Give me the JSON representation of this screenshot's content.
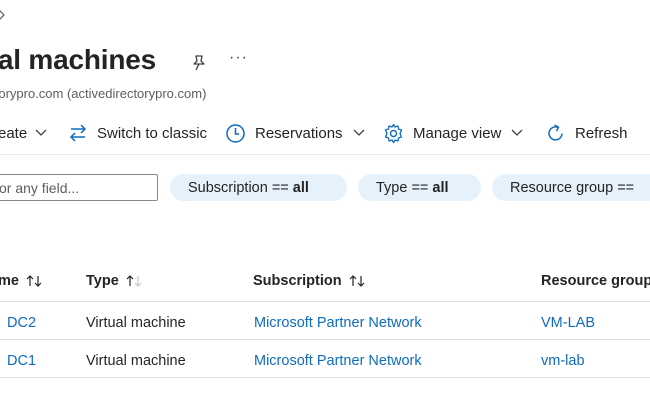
{
  "header": {
    "title": "ual machines",
    "subtitle": "ectorypro.com (activedirectorypro.com)",
    "more_label": "···"
  },
  "toolbar": {
    "create_label": "eate",
    "switch_label": "Switch to classic",
    "reservations_label": "Reservations",
    "manage_view_label": "Manage view",
    "refresh_label": "Refresh"
  },
  "filters": {
    "search_placeholder": "or any field...",
    "pills": [
      {
        "key": "Subscription ==",
        "value": "all"
      },
      {
        "key": "Type ==",
        "value": "all"
      },
      {
        "key": "Resource group ==",
        "value": ""
      }
    ]
  },
  "table": {
    "headers": [
      "me",
      "Type",
      "Subscription",
      "Resource group"
    ],
    "rows": [
      {
        "name": "DC2",
        "type": "Virtual machine",
        "subscription": "Microsoft Partner Network",
        "resource_group": "VM-LAB"
      },
      {
        "name": "DC1",
        "type": "Virtual machine",
        "subscription": "Microsoft Partner Network",
        "resource_group": "vm-lab"
      }
    ]
  },
  "colors": {
    "accent": "#0f6cbd",
    "pill_bg": "#e6f2fb",
    "text": "#242424"
  },
  "icons": [
    "chevron-right-icon",
    "pin-icon",
    "more-icon",
    "chevron-down-icon",
    "switch-arrows-icon",
    "clock-icon",
    "gear-icon",
    "refresh-icon",
    "sort-arrows-icon"
  ]
}
